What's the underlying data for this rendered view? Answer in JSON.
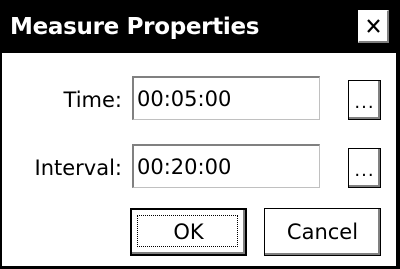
{
  "window": {
    "title": "Measure Properties",
    "close_glyph": "✕"
  },
  "form": {
    "time": {
      "label": "Time:",
      "value": "00:05:00",
      "browse_label": "..."
    },
    "interval": {
      "label": "Interval:",
      "value": "00:20:00",
      "browse_label": "..."
    }
  },
  "buttons": {
    "ok_label": "OK",
    "cancel_label": "Cancel"
  },
  "icons": {
    "close": "close-icon"
  },
  "colors": {
    "titlebar": "#000000",
    "title_text": "#ffffff",
    "background": "#ffffff",
    "bevel_shadow": "#808080"
  }
}
